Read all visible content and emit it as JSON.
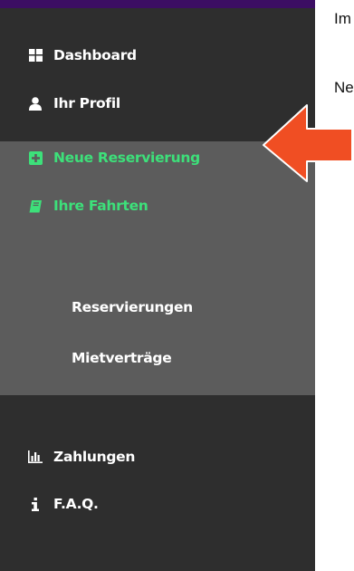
{
  "sidebar": {
    "items": [
      {
        "label": "Dashboard",
        "icon": "dashboard-grid-icon"
      },
      {
        "label": "Ihr Profil",
        "icon": "user-icon"
      },
      {
        "label": "Neue Reservierung",
        "icon": "plus-square-icon"
      },
      {
        "label": "Ihre Fahrten",
        "icon": "book-icon"
      },
      {
        "label": "Zahlungen",
        "icon": "bar-chart-icon"
      },
      {
        "label": "F.A.Q.",
        "icon": "info-icon"
      }
    ],
    "sub_items": [
      {
        "label": "Reservierungen"
      },
      {
        "label": "Mietverträge"
      }
    ]
  },
  "content": {
    "line1": "Im",
    "line2": "Ne"
  },
  "colors": {
    "sidebar_bg": "#2e2e2e",
    "expanded_bg": "#5c5c5c",
    "active_green": "#3de07a",
    "top_bar": "#3c0e63",
    "arrow_orange": "#f04e23"
  }
}
